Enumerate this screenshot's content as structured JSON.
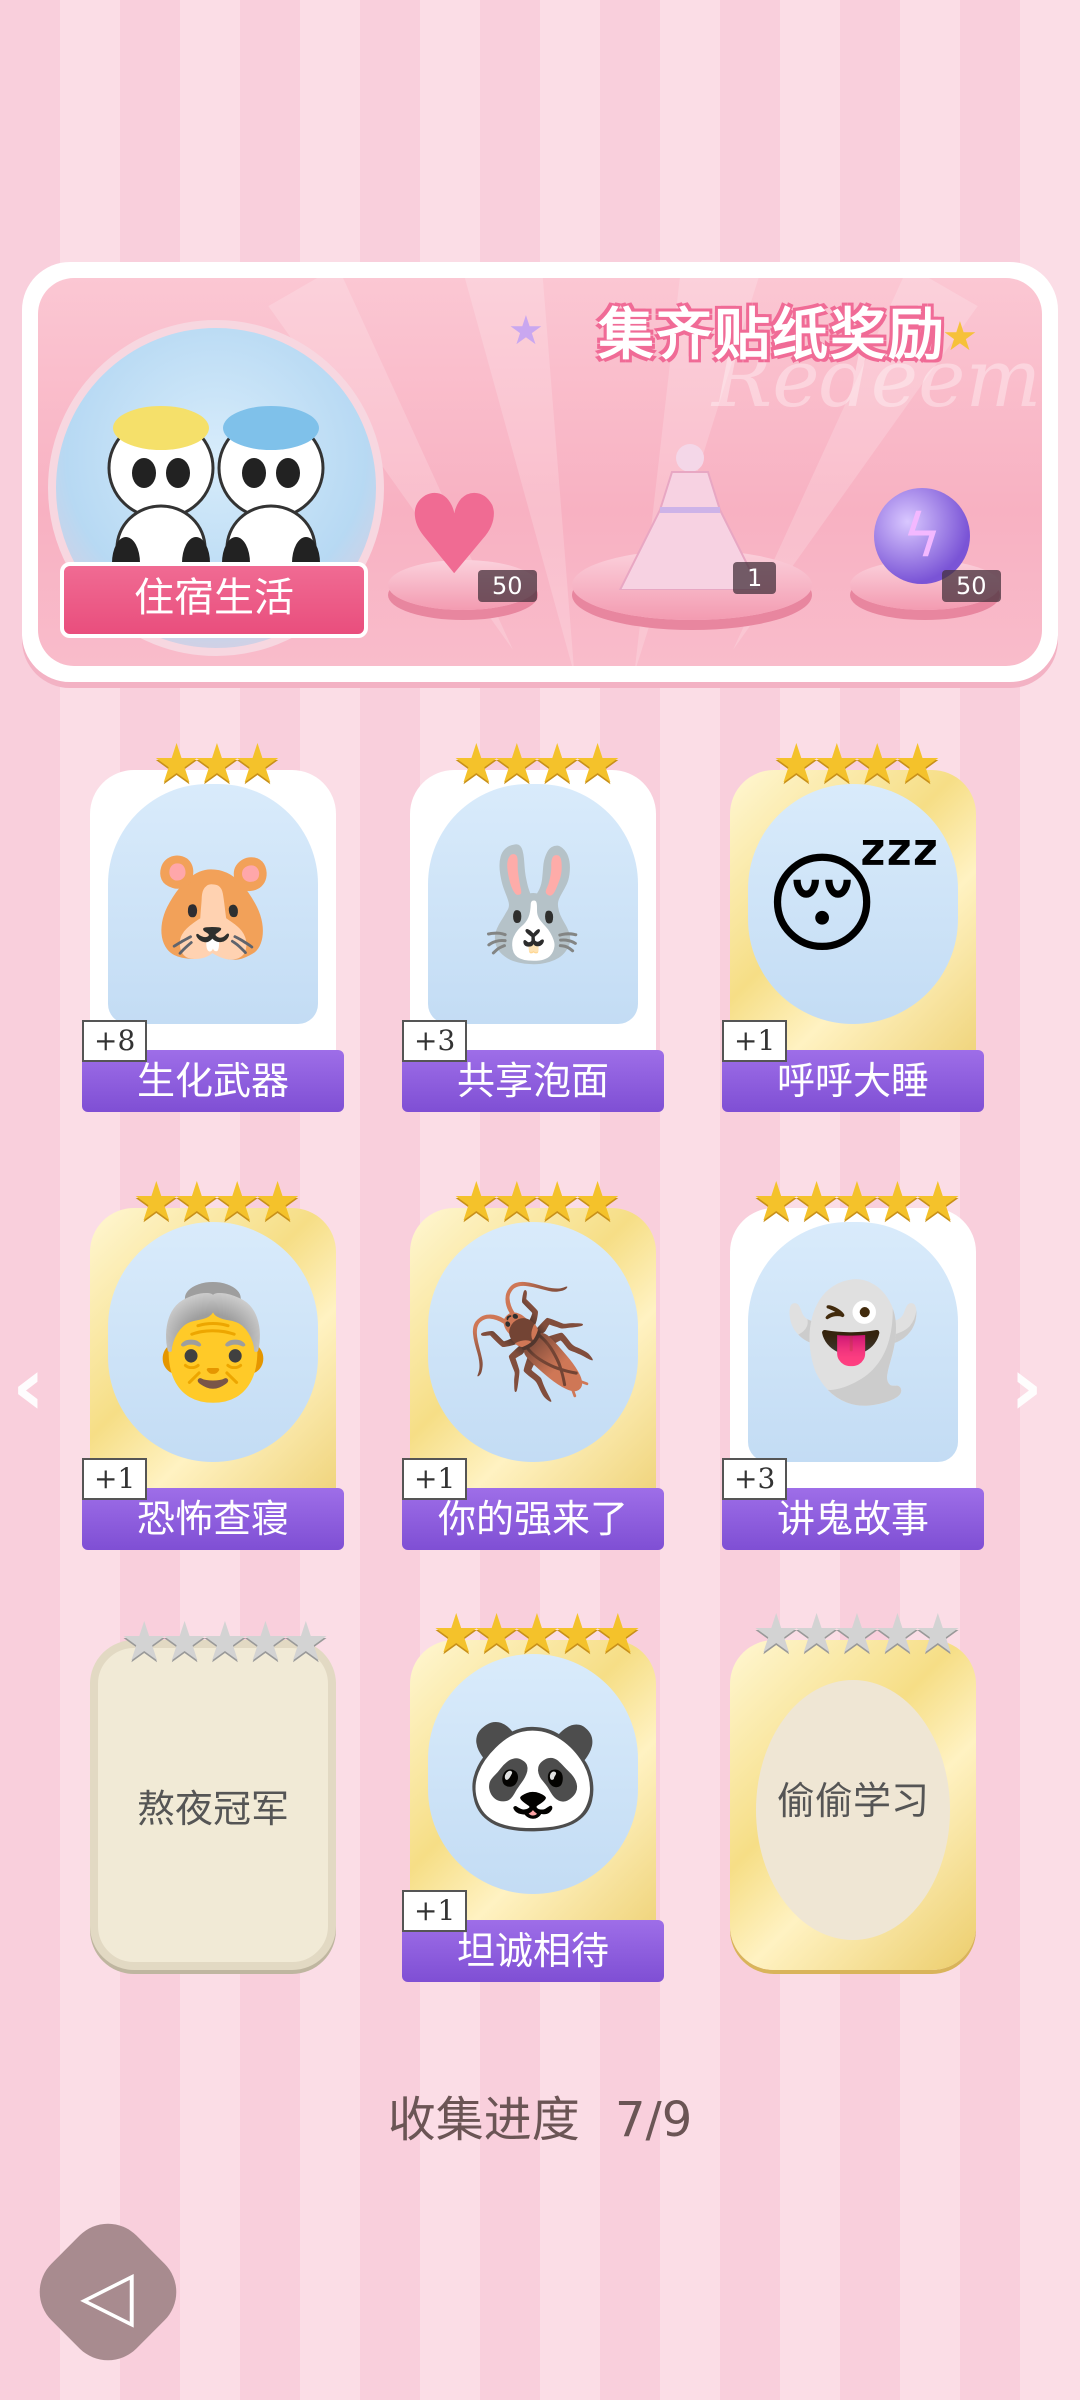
{
  "banner": {
    "title": "集齐贴纸奖励",
    "deco_text": "Redeem",
    "set_label": "住宿生活",
    "rewards": [
      {
        "name": "heart-gem",
        "count": "50"
      },
      {
        "name": "dress",
        "count": "1"
      },
      {
        "name": "energy-orb",
        "count": "50"
      }
    ]
  },
  "cards": [
    {
      "name": "生化武器",
      "plus": "+8",
      "stars": 3,
      "max_stars": 3,
      "collected": true,
      "icon": "capybara"
    },
    {
      "name": "共享泡面",
      "plus": "+3",
      "stars": 4,
      "max_stars": 4,
      "collected": true,
      "icon": "bunny-noodles"
    },
    {
      "name": "呼呼大睡",
      "plus": "+1",
      "stars": 4,
      "max_stars": 4,
      "collected": true,
      "icon": "sleeping-boy"
    },
    {
      "name": "恐怖查寝",
      "plus": "+1",
      "stars": 4,
      "max_stars": 4,
      "collected": true,
      "icon": "dorm-auntie"
    },
    {
      "name": "你的强来了",
      "plus": "+1",
      "stars": 4,
      "max_stars": 4,
      "collected": true,
      "icon": "cockroach"
    },
    {
      "name": "讲鬼故事",
      "plus": "+3",
      "stars": 5,
      "max_stars": 5,
      "collected": true,
      "icon": "ghost-boy"
    },
    {
      "name": "熬夜冠军",
      "plus": "",
      "stars": 0,
      "max_stars": 5,
      "collected": false,
      "icon": ""
    },
    {
      "name": "坦诚相待",
      "plus": "+1",
      "stars": 5,
      "max_stars": 5,
      "collected": true,
      "icon": "pandas"
    },
    {
      "name": "偷偷学习",
      "plus": "",
      "stars": 0,
      "max_stars": 5,
      "collected": false,
      "icon": ""
    }
  ],
  "progress": {
    "label": "收集进度",
    "value": "7/9"
  },
  "colors": {
    "accent": "#8a5ad8",
    "pink": "#f06b93",
    "gold": "#f4c22b"
  }
}
